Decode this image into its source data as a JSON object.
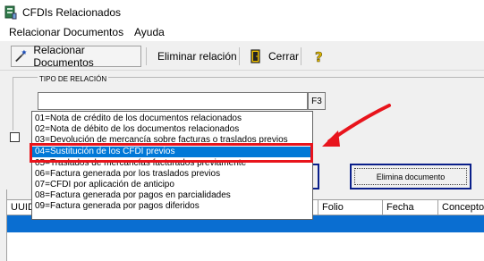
{
  "window": {
    "title": "CFDIs Relacionados"
  },
  "menu": {
    "items": [
      "Relacionar Documentos",
      "Ayuda"
    ]
  },
  "toolbar": {
    "relacionar_label": "Relacionar Documentos",
    "eliminar_label": "Eliminar relación",
    "cerrar_label": "Cerrar"
  },
  "form": {
    "tipo_label": "TIPO DE RELACIÓN",
    "f3_label": "F3",
    "input_value": ""
  },
  "dropdown": {
    "options": [
      "01=Nota de crédito de los documentos relacionados",
      "02=Nota de débito de los documentos relacionados",
      "03=Devolución de mercancía sobre facturas o traslados previos",
      "04=Sustitución de los CFDI previos",
      "05=Traslados de mercancías facturados previamente",
      "06=Factura generada por los traslados previos",
      "07=CFDI por aplicación de anticipo",
      "08=Factura generada por pagos en parcialidades",
      "09=Factura generada por pagos diferidos"
    ],
    "selected_index": 3
  },
  "buttons": {
    "elimina_documento": "Elimina documento"
  },
  "grid": {
    "columns": [
      "UUID",
      "Folio",
      "Fecha",
      "Concepto"
    ]
  },
  "colors": {
    "highlight": "#e8141c",
    "selection": "#0078d7",
    "button_border": "#0a1f8a"
  }
}
